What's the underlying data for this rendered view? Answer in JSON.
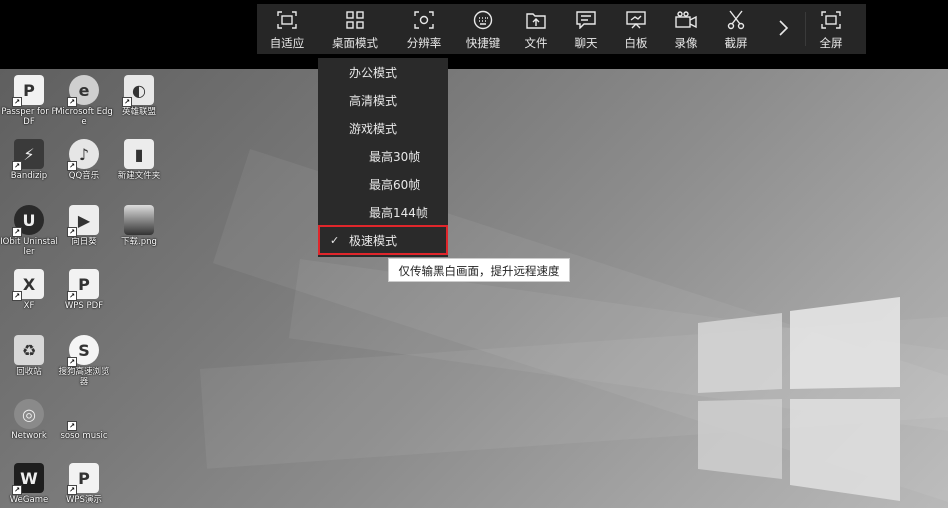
{
  "toolbar": {
    "items": [
      {
        "label": "自适应",
        "icon": "fit-icon"
      },
      {
        "label": "桌面模式",
        "icon": "grid-icon"
      },
      {
        "label": "分辨率",
        "icon": "resolution-icon"
      },
      {
        "label": "快捷键",
        "icon": "keyboard-icon"
      },
      {
        "label": "文件",
        "icon": "folder-upload-icon"
      },
      {
        "label": "聊天",
        "icon": "chat-icon"
      },
      {
        "label": "白板",
        "icon": "whiteboard-icon"
      },
      {
        "label": "录像",
        "icon": "camera-icon"
      },
      {
        "label": "截屏",
        "icon": "scissors-icon"
      },
      {
        "label": "",
        "icon": "chevron-right-icon"
      },
      {
        "label": "全屏",
        "icon": "fullscreen-icon"
      }
    ]
  },
  "dropdown": {
    "items": [
      "办公模式",
      "高清模式",
      "游戏模式",
      "最高30帧",
      "最高60帧",
      "最高144帧",
      "极速模式"
    ],
    "checked": "极速模式"
  },
  "tooltip": "仅传输黑白画面，提升远程速度",
  "desktop_icons": [
    {
      "label": "Passper for PDF"
    },
    {
      "label": "Microsoft Edge"
    },
    {
      "label": "英雄联盟"
    },
    {
      "label": "Bandizip"
    },
    {
      "label": "QQ音乐"
    },
    {
      "label": "新建文件夹"
    },
    {
      "label": "IObit Uninstaller"
    },
    {
      "label": "向日葵"
    },
    {
      "label": "下载.png"
    },
    {
      "label": "XF"
    },
    {
      "label": "WPS PDF"
    },
    {
      "label": "回收站"
    },
    {
      "label": "搜狗高速浏览器"
    },
    {
      "label": "Network"
    },
    {
      "label": "soso music"
    },
    {
      "label": "WeGame"
    },
    {
      "label": "WPS演示"
    }
  ]
}
